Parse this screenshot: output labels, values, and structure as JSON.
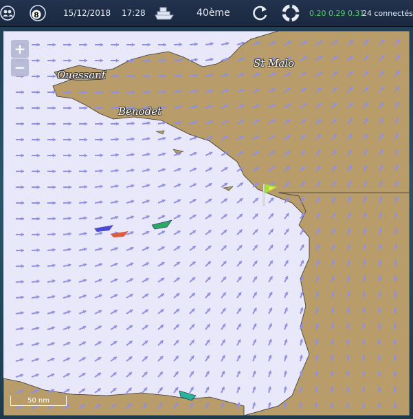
{
  "toolbar": {
    "date": "15/12/2018",
    "time": "17:28",
    "rank": "40ème",
    "stats": "0.20 0.29 0.31",
    "connected": "24 connectés",
    "badge": "8"
  },
  "icons": [
    "group-icon",
    "speed-badge-icon",
    "boat-icon",
    "refresh-icon",
    "lifebuoy-icon"
  ],
  "map": {
    "zoom_in": "+",
    "zoom_out": "−",
    "places": [
      "Ouessant",
      "Benodet",
      "St Malo"
    ],
    "scale_label": "50 nm",
    "colors": {
      "sea": "#e8e8fa",
      "land": "#b89d6a",
      "arrows": "#8f8fe6"
    }
  },
  "boats": [
    {
      "name": "blue-boat",
      "color": "#4b4bd2"
    },
    {
      "name": "red-boat",
      "color": "#e05a3c"
    },
    {
      "name": "green-boat",
      "color": "#2aa864"
    },
    {
      "name": "teal-boat",
      "color": "#2ab39a"
    }
  ]
}
